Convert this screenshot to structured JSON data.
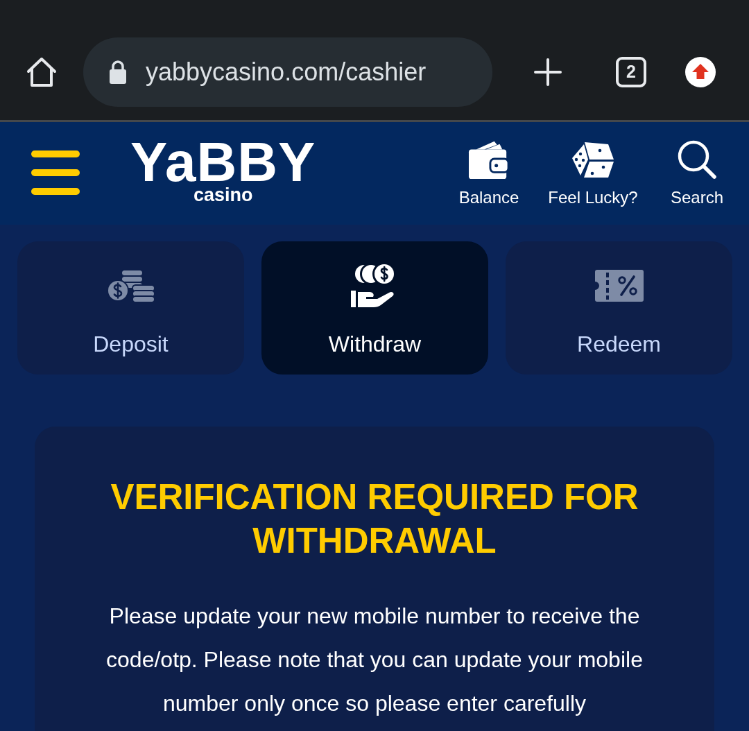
{
  "browser": {
    "url": "yabbycasino.com/cashier",
    "tab_count": "2"
  },
  "header": {
    "logo": {
      "wordmark": "YaBBY",
      "subtitle": "casino"
    },
    "actions": [
      {
        "kind": "balance",
        "label": "Balance"
      },
      {
        "kind": "lucky",
        "label": "Feel Lucky?"
      },
      {
        "kind": "search",
        "label": "Search"
      }
    ]
  },
  "tabs": [
    {
      "kind": "deposit",
      "label": "Deposit",
      "selected": false
    },
    {
      "kind": "withdraw",
      "label": "Withdraw",
      "selected": true
    },
    {
      "kind": "redeem",
      "label": "Redeem",
      "selected": false
    }
  ],
  "notice": {
    "title": "VERIFICATION REQUIRED FOR WITHDRAWAL",
    "message": "Please update your new mobile number to receive the code/otp. Please note that you can update your mobile number only once so please enter carefully"
  }
}
